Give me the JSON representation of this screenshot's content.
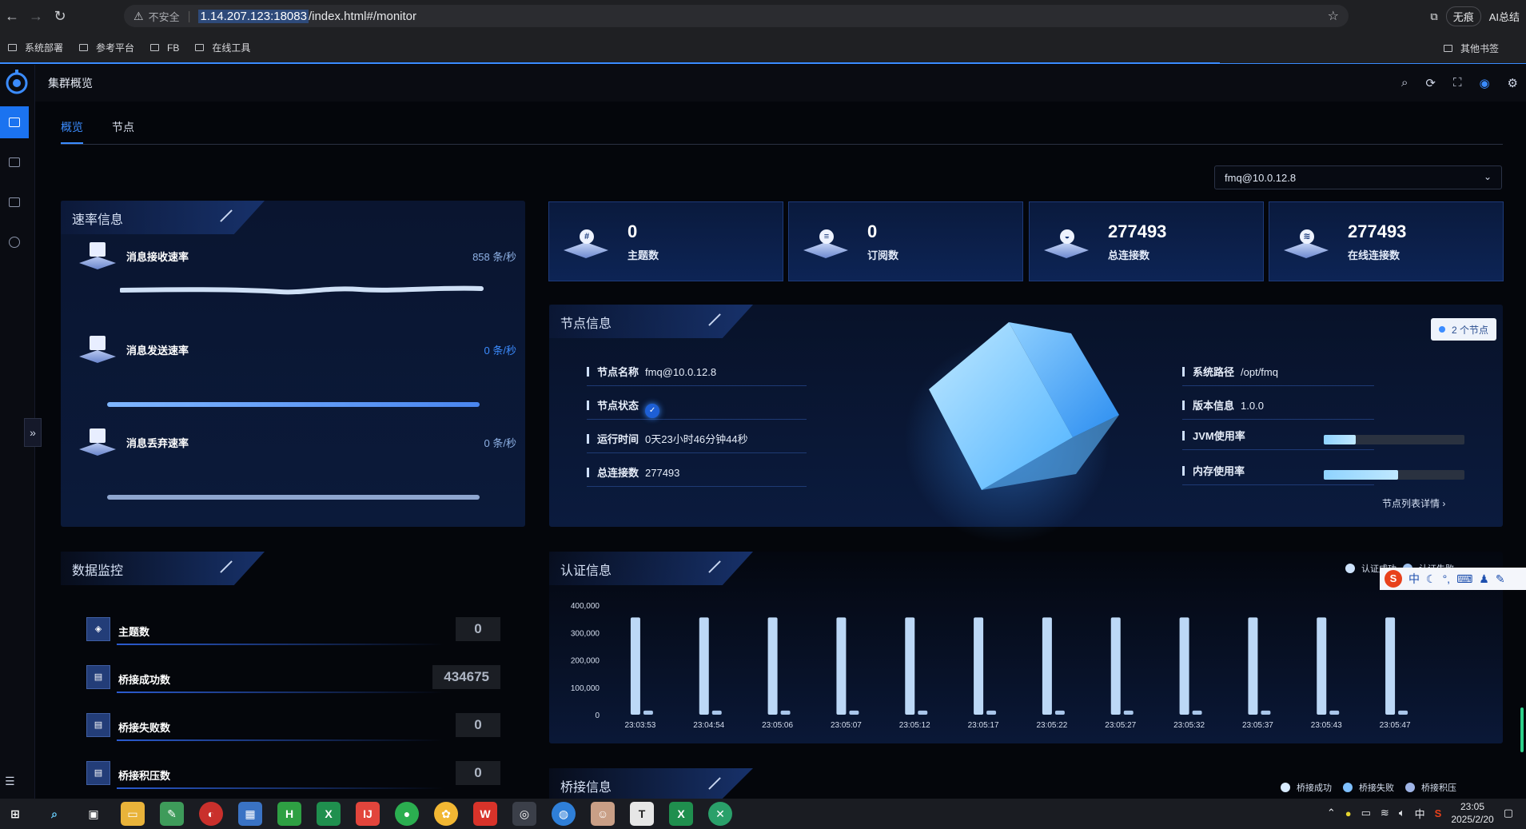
{
  "browser": {
    "insecure_label": "不安全",
    "url_host": "1.14.207.123:18083",
    "url_path": "/index.html#/monitor",
    "right_buttons": [
      "无痕",
      "AI总结"
    ],
    "bookmarks": [
      "系统部署",
      "参考平台",
      "FB",
      "在线工具"
    ],
    "other_bookmarks": "其他书签"
  },
  "topbar": {
    "title": "集群概览"
  },
  "tabs": [
    {
      "label": "概览"
    },
    {
      "label": "节点"
    }
  ],
  "node_select": {
    "value": "fmq@10.0.12.8"
  },
  "rate_panel": {
    "title": "速率信息",
    "rows": [
      {
        "label": "消息接收速率",
        "value": "858 条/秒"
      },
      {
        "label": "消息发送速率",
        "value": "0 条/秒"
      },
      {
        "label": "消息丢弃速率",
        "value": "0 条/秒"
      }
    ]
  },
  "stats": [
    {
      "value": "0",
      "label": "主题数",
      "icon": "hash-icon"
    },
    {
      "value": "0",
      "label": "订阅数",
      "icon": "subscription-icon"
    },
    {
      "value": "277493",
      "label": "总连接数",
      "icon": "connection-icon"
    },
    {
      "value": "277493",
      "label": "在线连接数",
      "icon": "wifi-icon"
    }
  ],
  "node_info": {
    "title": "节点信息",
    "badge": "2 个节点",
    "name_key": "节点名称",
    "name_val": "fmq@10.0.12.8",
    "status_key": "节点状态",
    "uptime_key": "运行时间",
    "uptime_val": "0天23小时46分钟44秒",
    "conn_key": "总连接数",
    "conn_val": "277493",
    "path_key": "系统路径",
    "path_val": "/opt/fmq",
    "version_key": "版本信息",
    "version_val": "1.0.0",
    "jvm_key": "JVM使用率",
    "jvm_pct": 0.23,
    "mem_key": "内存使用率",
    "mem_pct": 0.53,
    "detail_link": "节点列表详情 ›"
  },
  "monitor": {
    "title": "数据监控",
    "rows": [
      {
        "label": "主题数",
        "value": "0"
      },
      {
        "label": "桥接成功数",
        "value": "434675"
      },
      {
        "label": "桥接失败数",
        "value": "0"
      },
      {
        "label": "桥接积压数",
        "value": "0"
      }
    ]
  },
  "auth": {
    "title": "认证信息",
    "legend": [
      "认证成功",
      "认证失败"
    ]
  },
  "bridge": {
    "title": "桥接信息",
    "legend": [
      "桥接成功",
      "桥接失败",
      "桥接积压"
    ]
  },
  "chart_data": {
    "type": "bar",
    "categories": [
      "23:03:53",
      "23:04:54",
      "23:05:06",
      "23:05:07",
      "23:05:12",
      "23:05:17",
      "23:05:22",
      "23:05:27",
      "23:05:32",
      "23:05:37",
      "23:05:43",
      "23:05:47"
    ],
    "series": [
      {
        "name": "认证成功",
        "values": [
          355000,
          355000,
          355000,
          355000,
          355000,
          355000,
          355000,
          355000,
          355000,
          355000,
          355000,
          355000
        ]
      },
      {
        "name": "认证失败",
        "values": [
          15000,
          15000,
          15000,
          15000,
          15000,
          15000,
          15000,
          15000,
          15000,
          15000,
          15000,
          15000
        ]
      }
    ],
    "ylim": [
      0,
      400000
    ],
    "yticks": [
      "400,000",
      "300,000",
      "200,000",
      "100,000",
      "0"
    ],
    "xlabel": "",
    "ylabel": ""
  },
  "ime": {
    "label": "中"
  },
  "taskbar": {
    "time": "23:05",
    "date": "2025/2/20",
    "tray_lang": "中"
  }
}
